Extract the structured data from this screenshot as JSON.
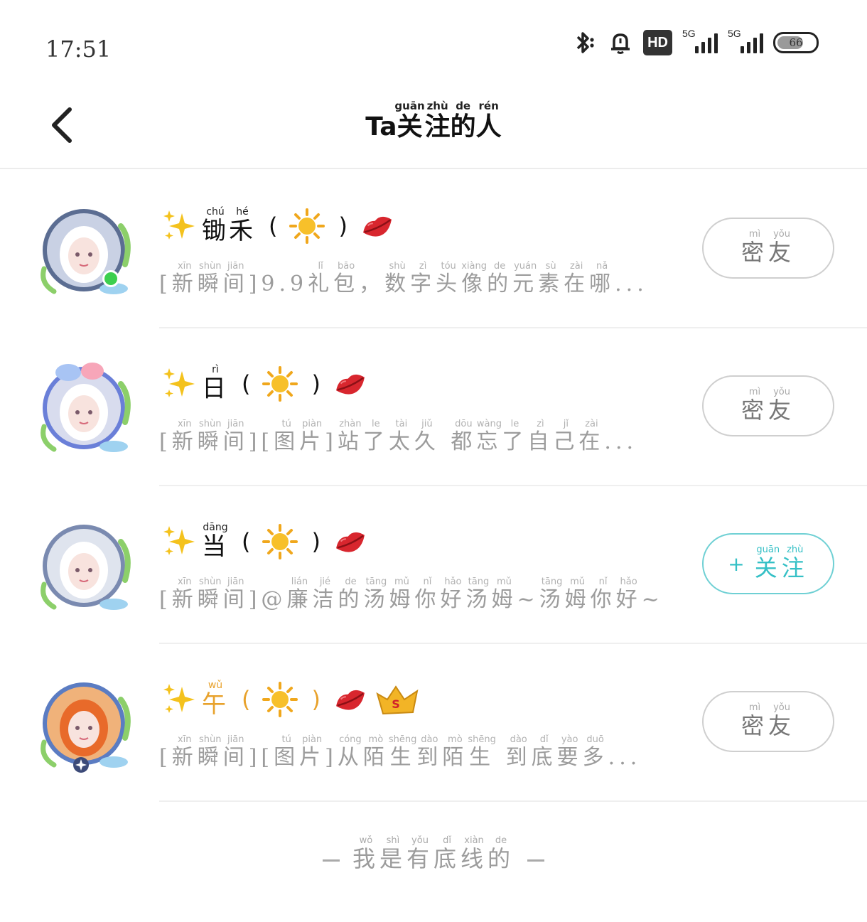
{
  "status_bar": {
    "time": "17:51",
    "signal_1_label": "5G",
    "signal_2_label": "5G",
    "hd_label": "HD",
    "battery_level": "66",
    "icons": [
      "bluetooth-icon",
      "alarm-icon",
      "hd-icon",
      "signal-icon",
      "signal-icon",
      "battery-icon"
    ]
  },
  "header": {
    "title_prefix": "Ta",
    "title_chars": [
      {
        "c": "关",
        "p": "guān"
      },
      {
        "c": "注",
        "p": "zhù"
      },
      {
        "c": "的",
        "p": "de"
      },
      {
        "c": "人",
        "p": "rén"
      }
    ]
  },
  "users": [
    {
      "name_chars": [
        {
          "c": "锄",
          "p": "chú"
        },
        {
          "c": "禾",
          "p": "hé"
        }
      ],
      "emojis": [
        "sparkles",
        "sun",
        "lips"
      ],
      "preview": [
        {
          "c": "[",
          "p": ""
        },
        {
          "c": "新",
          "p": "xīn"
        },
        {
          "c": "瞬",
          "p": "shùn"
        },
        {
          "c": "间",
          "p": "jiān"
        },
        {
          "c": "]9.9",
          "p": ""
        },
        {
          "c": "礼",
          "p": "lǐ"
        },
        {
          "c": "包",
          "p": "bāo"
        },
        {
          "c": "，",
          "p": ""
        },
        {
          "c": "数",
          "p": "shù"
        },
        {
          "c": "字",
          "p": "zì"
        },
        {
          "c": "头",
          "p": "tóu"
        },
        {
          "c": "像",
          "p": "xiàng"
        },
        {
          "c": "的",
          "p": "de"
        },
        {
          "c": "元",
          "p": "yuán"
        },
        {
          "c": "素",
          "p": "sù"
        },
        {
          "c": "在",
          "p": "zài"
        },
        {
          "c": "哪",
          "p": "nǎ"
        },
        {
          "c": "...",
          "p": ""
        }
      ],
      "action": {
        "type": "friend",
        "chars": [
          {
            "c": "密",
            "p": "mì"
          },
          {
            "c": "友",
            "p": "yǒu"
          }
        ]
      }
    },
    {
      "name_chars": [
        {
          "c": "日",
          "p": "rì"
        }
      ],
      "emojis": [
        "sparkles",
        "sun",
        "lips"
      ],
      "preview": [
        {
          "c": "[",
          "p": ""
        },
        {
          "c": "新",
          "p": "xīn"
        },
        {
          "c": "瞬",
          "p": "shùn"
        },
        {
          "c": "间",
          "p": "jiān"
        },
        {
          "c": "][",
          "p": ""
        },
        {
          "c": "图",
          "p": "tú"
        },
        {
          "c": "片",
          "p": "piàn"
        },
        {
          "c": "]",
          "p": ""
        },
        {
          "c": "站",
          "p": "zhàn"
        },
        {
          "c": "了",
          "p": "le"
        },
        {
          "c": "太",
          "p": "tài"
        },
        {
          "c": "久",
          "p": "jiǔ"
        },
        {
          "c": " ",
          "p": ""
        },
        {
          "c": "都",
          "p": "dōu"
        },
        {
          "c": "忘",
          "p": "wàng"
        },
        {
          "c": "了",
          "p": "le"
        },
        {
          "c": "自",
          "p": "zì"
        },
        {
          "c": "己",
          "p": "jǐ"
        },
        {
          "c": "在",
          "p": "zài"
        },
        {
          "c": "...",
          "p": ""
        }
      ],
      "action": {
        "type": "friend",
        "chars": [
          {
            "c": "密",
            "p": "mì"
          },
          {
            "c": "友",
            "p": "yǒu"
          }
        ]
      }
    },
    {
      "name_chars": [
        {
          "c": "当",
          "p": "dāng"
        }
      ],
      "emojis": [
        "sparkles",
        "sun",
        "lips"
      ],
      "preview": [
        {
          "c": "[",
          "p": ""
        },
        {
          "c": "新",
          "p": "xīn"
        },
        {
          "c": "瞬",
          "p": "shùn"
        },
        {
          "c": "间",
          "p": "jiān"
        },
        {
          "c": "]@",
          "p": ""
        },
        {
          "c": "廉",
          "p": "lián"
        },
        {
          "c": "洁",
          "p": "jié"
        },
        {
          "c": "的",
          "p": "de"
        },
        {
          "c": "汤",
          "p": "tāng"
        },
        {
          "c": "姆",
          "p": "mǔ"
        },
        {
          "c": "你",
          "p": "nǐ"
        },
        {
          "c": "好",
          "p": "hǎo"
        },
        {
          "c": "汤",
          "p": "tāng"
        },
        {
          "c": "姆",
          "p": "mǔ"
        },
        {
          "c": "~",
          "p": ""
        },
        {
          "c": "汤",
          "p": "tāng"
        },
        {
          "c": "姆",
          "p": "mǔ"
        },
        {
          "c": "你",
          "p": "nǐ"
        },
        {
          "c": "好",
          "p": "hǎo"
        },
        {
          "c": "~",
          "p": ""
        }
      ],
      "action": {
        "type": "follow",
        "plus": "+",
        "chars": [
          {
            "c": "关",
            "p": "guān"
          },
          {
            "c": "注",
            "p": "zhù"
          }
        ]
      }
    },
    {
      "name_chars": [
        {
          "c": "午",
          "p": "wǔ"
        }
      ],
      "name_color": "#e8a22c",
      "emojis": [
        "sparkles",
        "sun",
        "lips",
        "crown"
      ],
      "preview": [
        {
          "c": "[",
          "p": ""
        },
        {
          "c": "新",
          "p": "xīn"
        },
        {
          "c": "瞬",
          "p": "shùn"
        },
        {
          "c": "间",
          "p": "jiān"
        },
        {
          "c": "][",
          "p": ""
        },
        {
          "c": "图",
          "p": "tú"
        },
        {
          "c": "片",
          "p": "piàn"
        },
        {
          "c": "]",
          "p": ""
        },
        {
          "c": "从",
          "p": "cóng"
        },
        {
          "c": "陌",
          "p": "mò"
        },
        {
          "c": "生",
          "p": "shēng"
        },
        {
          "c": "到",
          "p": "dào"
        },
        {
          "c": "陌",
          "p": "mò"
        },
        {
          "c": "生",
          "p": "shēng"
        },
        {
          "c": " ",
          "p": ""
        },
        {
          "c": "到",
          "p": "dào"
        },
        {
          "c": "底",
          "p": "dǐ"
        },
        {
          "c": "要",
          "p": "yào"
        },
        {
          "c": "多",
          "p": "duō"
        },
        {
          "c": "...",
          "p": ""
        }
      ],
      "action": {
        "type": "friend",
        "chars": [
          {
            "c": "密",
            "p": "mì"
          },
          {
            "c": "友",
            "p": "yǒu"
          }
        ]
      }
    }
  ],
  "footer": {
    "chars": [
      {
        "c": "我",
        "p": "wǒ"
      },
      {
        "c": "是",
        "p": "shì"
      },
      {
        "c": "有",
        "p": "yǒu"
      },
      {
        "c": "底",
        "p": "dǐ"
      },
      {
        "c": "线",
        "p": "xiàn"
      },
      {
        "c": "的",
        "p": "de"
      }
    ]
  },
  "colors": {
    "follow_accent": "#35c0c6",
    "friend_border": "#cfcfcf",
    "preview_text": "#9c9c9c",
    "online_dot": "#3ccf4e"
  }
}
